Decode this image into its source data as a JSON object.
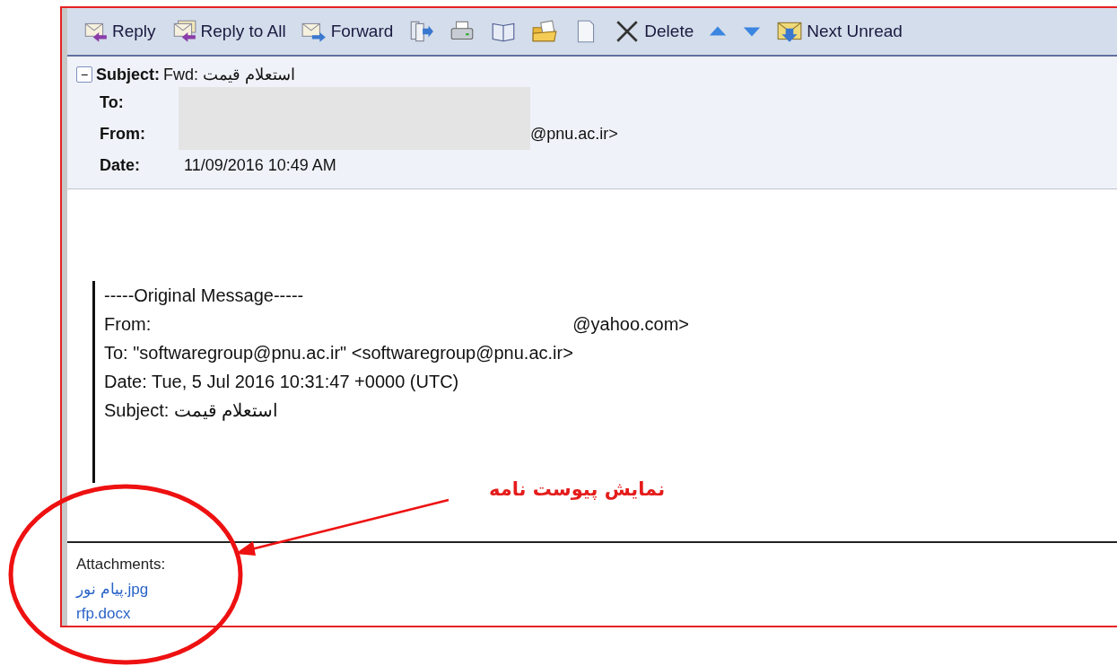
{
  "toolbar": {
    "buttons": [
      {
        "kind": "reply",
        "label": "Reply"
      },
      {
        "kind": "replyall",
        "label": "Reply to All"
      },
      {
        "kind": "forward",
        "label": "Forward"
      },
      {
        "kind": "move"
      },
      {
        "kind": "print"
      },
      {
        "kind": "book"
      },
      {
        "kind": "folder"
      },
      {
        "kind": "page"
      },
      {
        "kind": "delete",
        "label": "Delete"
      },
      {
        "kind": "up"
      },
      {
        "kind": "down"
      },
      {
        "kind": "nextunread",
        "label": "Next Unread"
      }
    ]
  },
  "header": {
    "collapse_symbol": "−",
    "subject_label": "Subject:",
    "subject": "Fwd: استعلام قیمت",
    "fields": [
      {
        "label": "To:",
        "redacted": true
      },
      {
        "label": "From:",
        "redacted": true,
        "value": "@pnu.ac.ir>"
      },
      {
        "label": "Date:",
        "redacted": false,
        "value": "11/09/2016 10:49 AM"
      }
    ]
  },
  "body": {
    "quoted_lines": [
      {
        "kind": "plain",
        "text": "-----Original Message-----"
      },
      {
        "kind": "gap",
        "label": "From:",
        "text": "@yahoo.com>"
      },
      {
        "kind": "plain",
        "text": "To: \"softwaregroup@pnu.ac.ir\" <softwaregroup@pnu.ac.ir>"
      },
      {
        "kind": "plain",
        "text": "Date: Tue, 5 Jul 2016 10:31:47 +0000 (UTC)"
      },
      {
        "kind": "plain",
        "text": "Subject: استعلام قیمت"
      }
    ]
  },
  "attachments": {
    "label": "Attachments:",
    "files": [
      "پیام نور.jpg",
      "rfp.docx"
    ]
  },
  "annotation": {
    "text": "نمایش پیوست نامه"
  }
}
